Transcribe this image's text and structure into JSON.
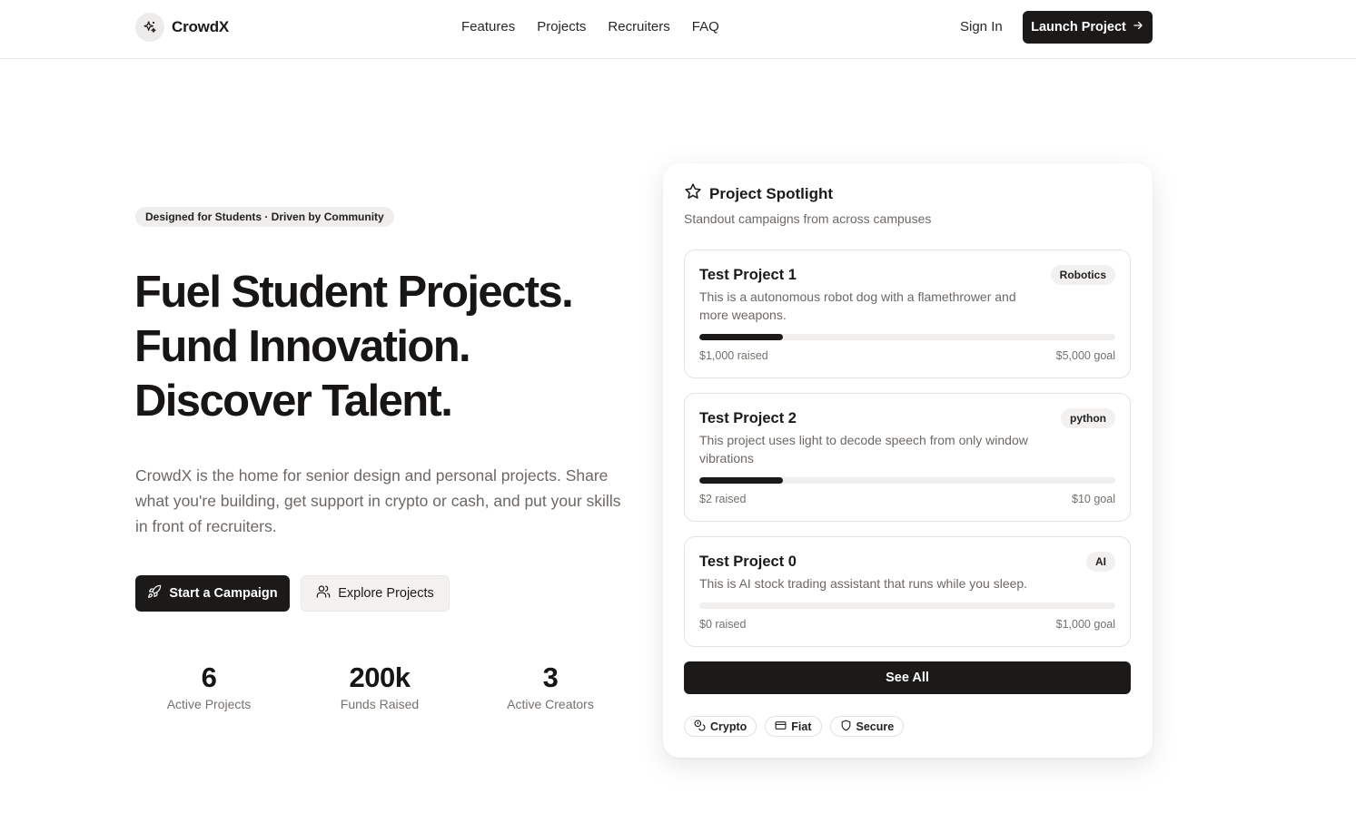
{
  "brand": {
    "name": "CrowdX",
    "icon": "sparkles-icon"
  },
  "nav": {
    "links": [
      "Features",
      "Projects",
      "Recruiters",
      "FAQ"
    ],
    "sign_in": "Sign In",
    "launch": "Launch Project"
  },
  "hero": {
    "badge": "Designed for Students · Driven by Community",
    "headline": [
      "Fuel Student Projects.",
      "Fund Innovation.",
      "Discover Talent."
    ],
    "lede": "CrowdX is the home for senior design and personal projects. Share what you're building, get support in crypto or cash, and put your skills in front of recruiters.",
    "primary_cta": "Start a Campaign",
    "secondary_cta": "Explore Projects",
    "stats": [
      {
        "value": "6",
        "label": "Active Projects"
      },
      {
        "value": "200k",
        "label": "Funds Raised"
      },
      {
        "value": "3",
        "label": "Active Creators"
      }
    ]
  },
  "spotlight": {
    "title": "Project Spotlight",
    "subtitle": "Standout campaigns from across campuses",
    "projects": [
      {
        "name": "Test Project 1",
        "tag": "Robotics",
        "description": "This is a autonomous robot dog with a flamethrower and more weapons.",
        "raised": "$1,000 raised",
        "goal": "$5,000 goal",
        "progress": 0.2
      },
      {
        "name": "Test Project 2",
        "tag": "python",
        "description": "This project uses light to decode speech from only window vibrations",
        "raised": "$2 raised",
        "goal": "$10 goal",
        "progress": 0.2
      },
      {
        "name": "Test Project 0",
        "tag": "AI",
        "description": "This is AI stock trading assistant that runs while you sleep.",
        "raised": "$0 raised",
        "goal": "$1,000 goal",
        "progress": 0
      }
    ],
    "see_all": "See All",
    "chips": [
      {
        "label": "Crypto",
        "icon": "coins-icon"
      },
      {
        "label": "Fiat",
        "icon": "credit-card-icon"
      },
      {
        "label": "Secure",
        "icon": "shield-icon"
      }
    ]
  },
  "colors": {
    "primary": "#1c1a19",
    "muted_text": "#6d6864",
    "surface": "#f2f1ef",
    "border": "#e5e3e0"
  }
}
